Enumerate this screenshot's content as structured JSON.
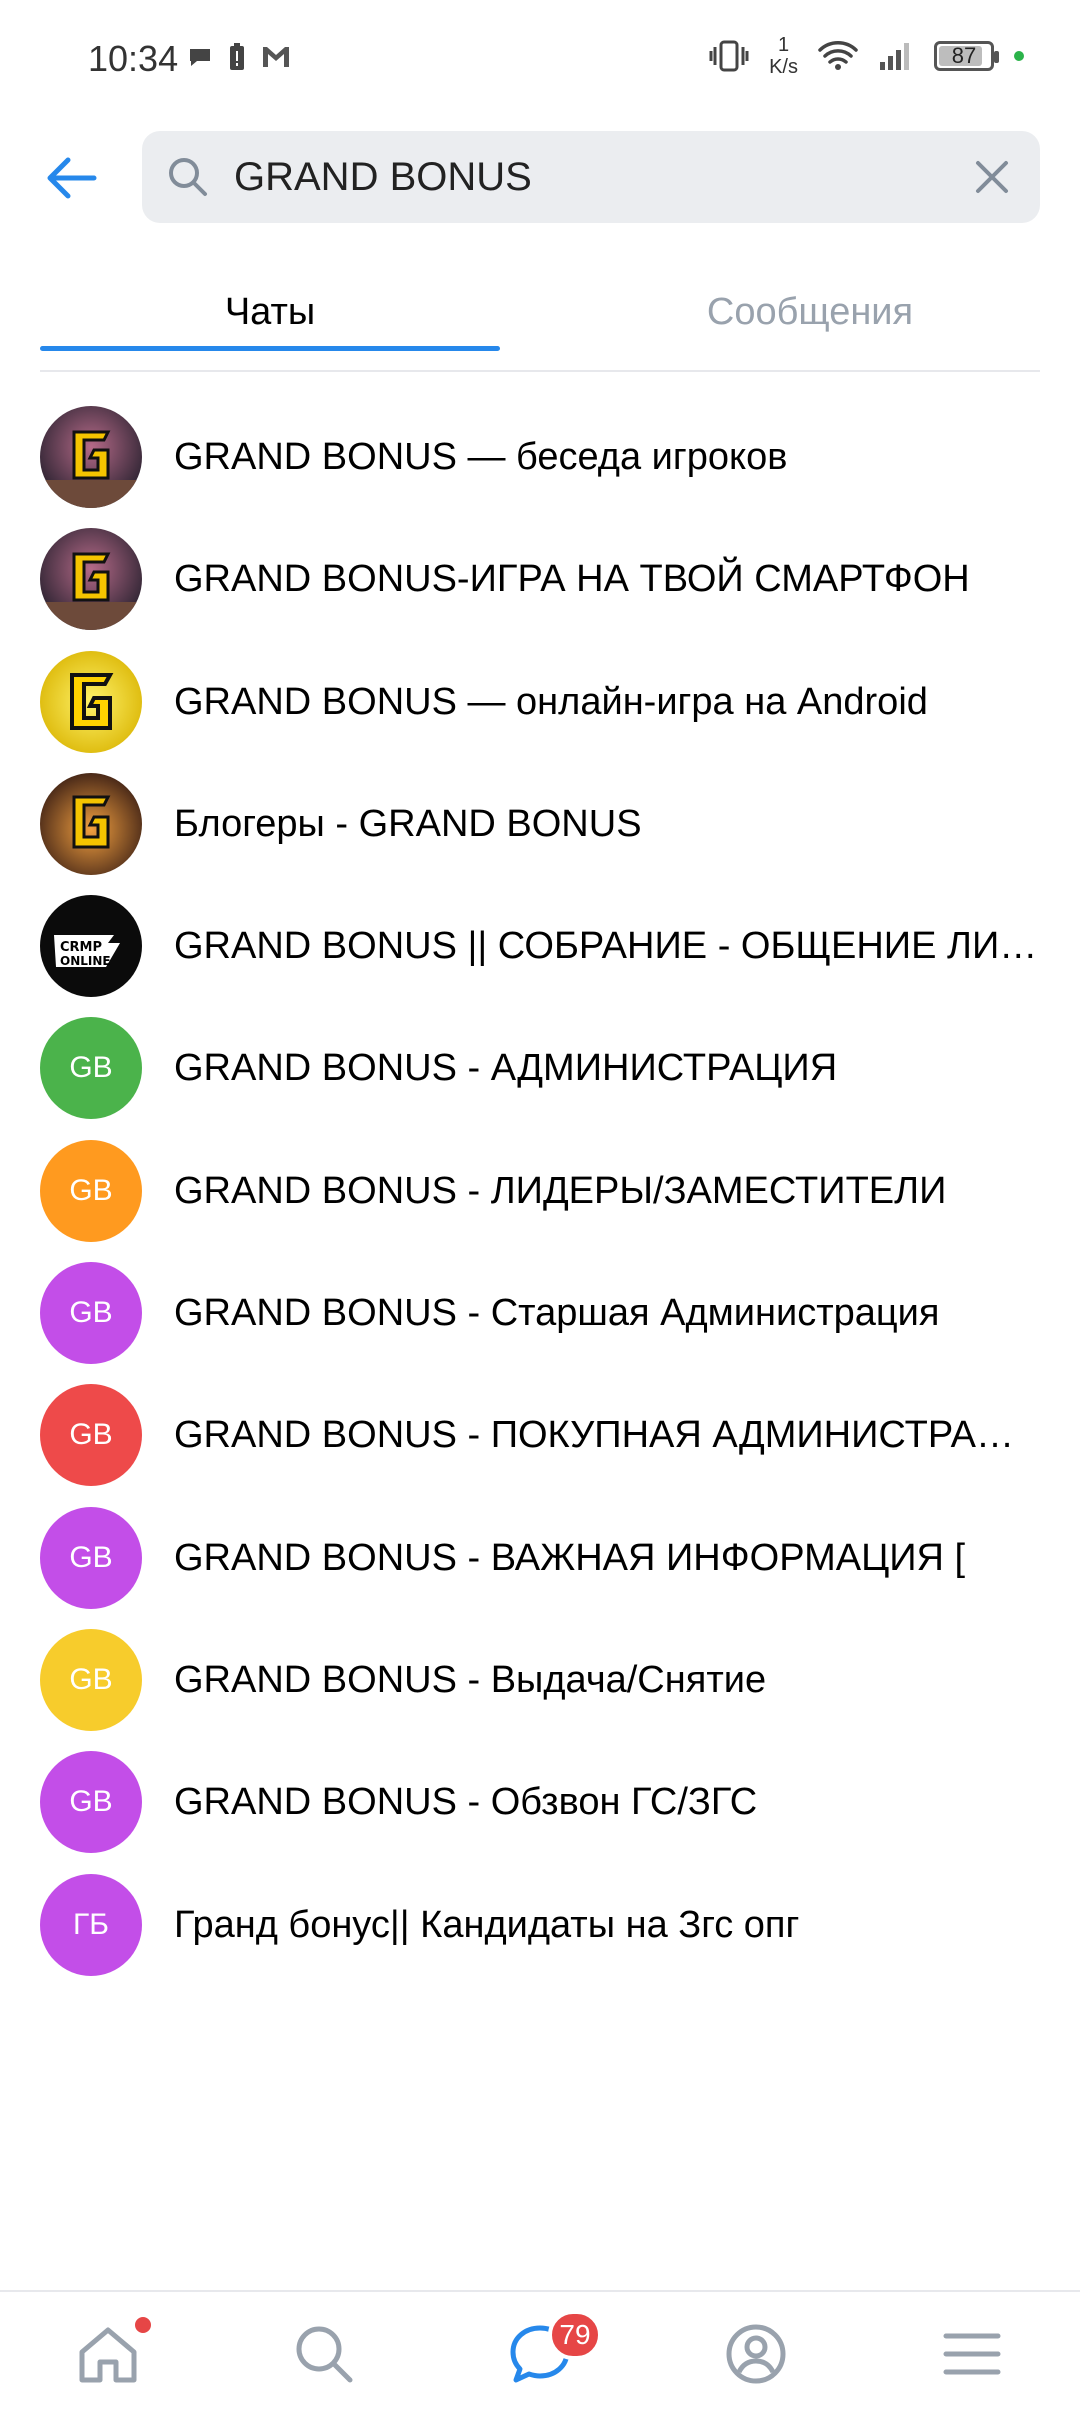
{
  "status_bar": {
    "time": "10:34",
    "speed_value": "1",
    "speed_unit": "K/s",
    "battery": "87",
    "battery_level": 0.87
  },
  "search": {
    "query": "GRAND BONUS"
  },
  "tabs": [
    {
      "label": "Чаты",
      "active": true
    },
    {
      "label": "Сообщения",
      "active": false
    }
  ],
  "chats": [
    {
      "title": "GRAND BONUS — беседа игроков",
      "avatar": "logo-g-dark",
      "initials": ""
    },
    {
      "title": "GRAND BONUS-ИГРА НА ТВОЙ СМАРТФОН",
      "avatar": "logo-g-dark",
      "initials": ""
    },
    {
      "title": "GRAND BONUS — онлайн-игра на Android",
      "avatar": "logo-g-yellow",
      "initials": ""
    },
    {
      "title": "Блогеры - GRAND BONUS",
      "avatar": "logo-g-fire",
      "initials": ""
    },
    {
      "title": "GRAND BONUS || СОБРАНИЕ - ОБЩЕНИЕ ЛИДЕРОВ",
      "avatar": "logo-crmp-online",
      "initials": ""
    },
    {
      "title": "GRAND BONUS - АДМИНИСТРАЦИЯ",
      "avatar": "initials",
      "initials": "GB",
      "color": "#4bb34b"
    },
    {
      "title": "GRAND BONUS - ЛИДЕРЫ/ЗАМЕСТИТЕЛИ",
      "avatar": "initials",
      "initials": "GB",
      "color": "#ff9a1f"
    },
    {
      "title": "GRAND BONUS - Старшая Администрация",
      "avatar": "initials",
      "initials": "GB",
      "color": "#c34ee8"
    },
    {
      "title": "GRAND BONUS - ПОКУПНАЯ АДМИНИСТРАЦИЯ",
      "avatar": "initials",
      "initials": "GB",
      "color": "#ee4a4a"
    },
    {
      "title": "GRAND BONUS - ВАЖНАЯ ИНФОРМАЦИЯ [",
      "avatar": "initials",
      "initials": "GB",
      "color": "#c34ee8"
    },
    {
      "title": "GRAND BONUS - Выдача/Снятие",
      "avatar": "initials",
      "initials": "GB",
      "color": "#f7cc2c"
    },
    {
      "title": "GRAND BONUS - Обзвон ГС/ЗГС",
      "avatar": "initials",
      "initials": "GB",
      "color": "#c34ee8"
    },
    {
      "title": "Гранд бонус|| Кандидаты на Згс опг",
      "avatar": "initials",
      "initials": "ГБ",
      "color": "#c34ee8"
    }
  ],
  "bottom_nav": {
    "items": [
      "home-icon",
      "search-icon",
      "messages-icon",
      "profile-icon",
      "menu-icon"
    ],
    "messages_badge": "79"
  },
  "colors": {
    "accent": "#2688eb",
    "badge": "#e64646",
    "inactive_tab": "#99a2ad"
  }
}
